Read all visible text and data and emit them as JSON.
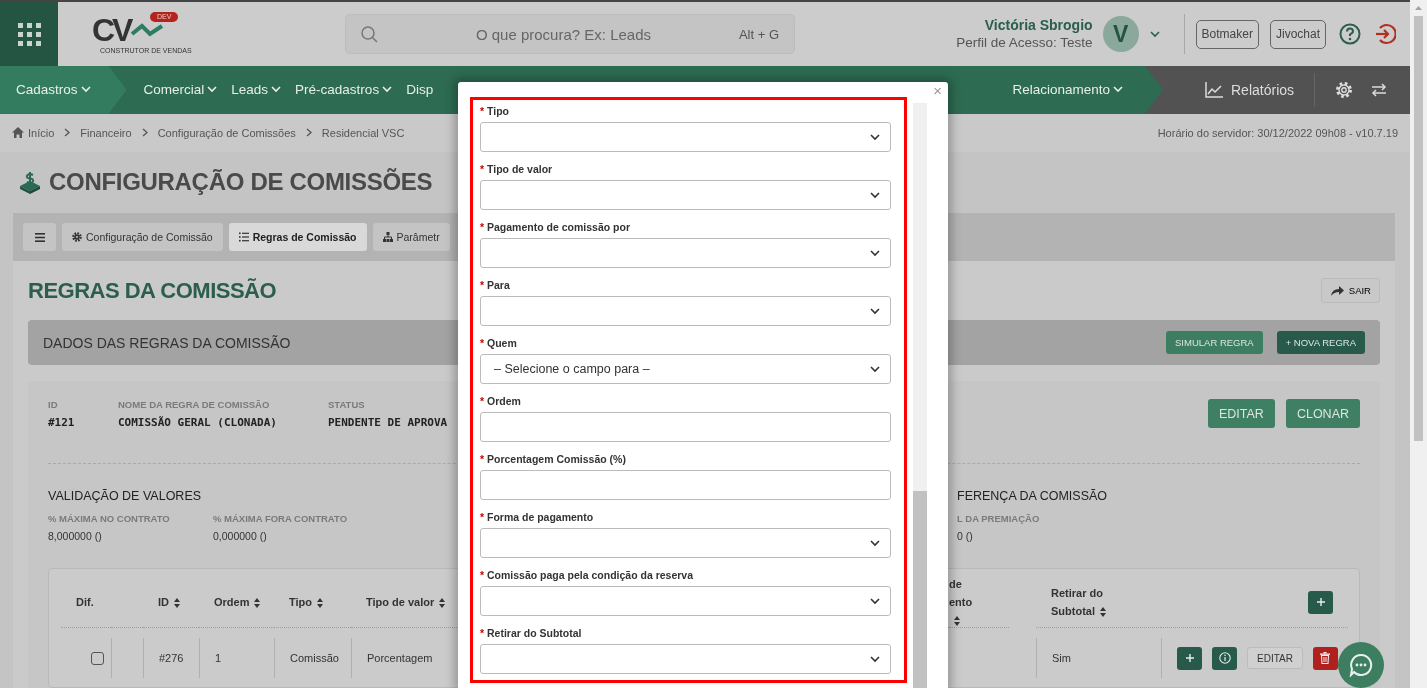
{
  "header": {
    "logo": {
      "letters": "CV",
      "badge": "DEV",
      "tagline": "CONSTRUTOR DE VENDAS"
    },
    "search": {
      "placeholder": "O que procura? Ex: Leads",
      "shortcut": "Alt + G"
    },
    "user": {
      "name": "Victória Sbrogio",
      "profile": "Perfil de Acesso: Teste",
      "initial": "V"
    },
    "buttons": [
      "Botmaker",
      "Jivochat"
    ]
  },
  "nav": {
    "items": [
      {
        "label": "Cadastros",
        "selected": true
      },
      {
        "label": "Comercial",
        "selected": false
      },
      {
        "label": "Leads",
        "selected": false
      },
      {
        "label": "Pré-cadastros",
        "selected": false
      },
      {
        "label": "Disp",
        "selected": false
      }
    ],
    "right_item": "Relacionamento",
    "reports": "Relatórios"
  },
  "breadcrumb": {
    "items": [
      "Início",
      "Financeiro",
      "Configuração de Comissões",
      "Residencial VSC"
    ],
    "server_time": "Horário do servidor: 30/12/2022 09h08 - v10.7.19"
  },
  "page_title": "CONFIGURAÇÃO DE COMISSÕES",
  "tabs": [
    {
      "label": "Configuração de Comissão",
      "selected": false
    },
    {
      "label": "Regras de Comissão",
      "selected": true
    },
    {
      "label": "Parâmetr",
      "selected": false
    }
  ],
  "section_title": "REGRAS DA COMISSÃO",
  "exit_button": "SAIR",
  "panel": {
    "title": "DADOS DAS REGRAS DA COMISSÃO",
    "buttons": [
      {
        "label": "SIMULAR REGRA",
        "kind": "secondary"
      },
      {
        "label": "+ NOVA REGRA",
        "kind": "primary"
      }
    ]
  },
  "rule": {
    "fields": [
      {
        "label": "ID",
        "value": "#121"
      },
      {
        "label": "NOME DA REGRA DE COMISSÃO",
        "value": "COMISSÃO GERAL (CLONADA)"
      },
      {
        "label": "STATUS",
        "value": "PENDENTE DE APROVA"
      }
    ],
    "actions": [
      "EDITAR",
      "CLONAR"
    ]
  },
  "validation": {
    "title": "VALIDAÇÃO DE VALORES",
    "fields": [
      {
        "label": "% MÁXIMA NO CONTRATO",
        "value": "8,000000 ()"
      },
      {
        "label": "% MÁXIMA FORA CONTRATO",
        "value": "0,000000 ()"
      }
    ]
  },
  "difference": {
    "title": "FERENÇA DA COMISSÃO",
    "fields": [
      {
        "label": "L DA PREMIAÇÃO",
        "value": "0 ()"
      }
    ]
  },
  "table": {
    "columns": [
      {
        "label": "Dif.",
        "sortable": false
      },
      {
        "label": "ID",
        "sortable": true
      },
      {
        "label": "Ordem",
        "sortable": true
      },
      {
        "label": "Tipo",
        "sortable": true
      },
      {
        "label": "Tipo de valor",
        "sortable": true
      },
      {
        "label": "de ento",
        "sortable": true
      },
      {
        "label": "Retirar do Subtotal",
        "sortable": true
      }
    ],
    "rows": [
      {
        "checked": false,
        "id": "#276",
        "ordem": "1",
        "tipo": "Comissão",
        "tipo_de_valor": "Porcentagem",
        "retirar": "Sim",
        "edit_button": "EDITAR"
      }
    ]
  },
  "modal": {
    "close": "×",
    "fields": [
      {
        "mark": "*",
        "label": "Tipo",
        "kind": "select"
      },
      {
        "mark": "*",
        "label": "Tipo de valor",
        "kind": "select"
      },
      {
        "mark": "*",
        "label": "Pagamento de comissão por",
        "kind": "select"
      },
      {
        "mark": "*",
        "label": "Para",
        "kind": "select"
      },
      {
        "mark": "*",
        "label": "Quem",
        "kind": "select",
        "value": "– Selecione o campo para –"
      },
      {
        "mark": "*",
        "label": "Ordem",
        "kind": "input"
      },
      {
        "mark": "*",
        "label": "Porcentagem Comissão (%)",
        "kind": "input"
      },
      {
        "mark": "*",
        "label": "Forma de pagamento",
        "kind": "select"
      },
      {
        "mark": "*",
        "label": "Comissão paga pela condição da reserva",
        "kind": "select"
      },
      {
        "mark": "*",
        "label": "Retirar do Subtotal",
        "kind": "select"
      }
    ]
  }
}
